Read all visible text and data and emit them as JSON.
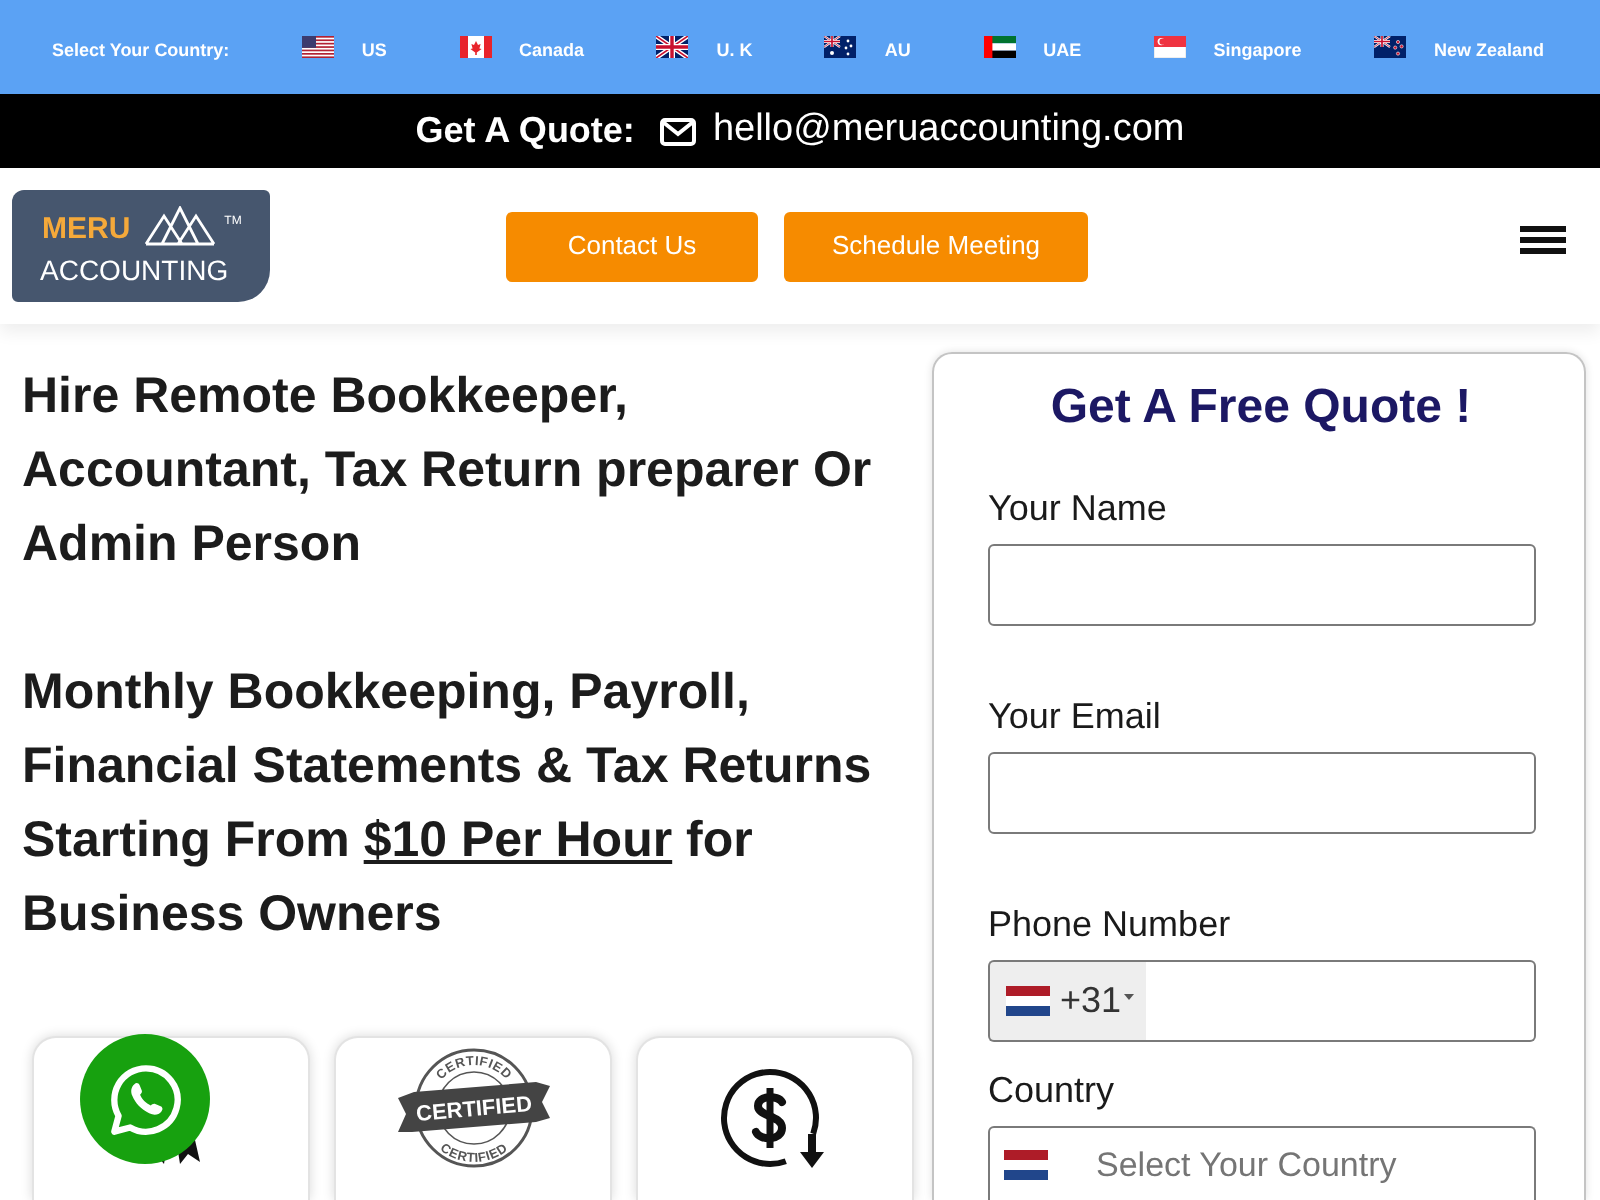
{
  "country_bar": {
    "label": "Select Your Country:",
    "countries": [
      {
        "name": "US"
      },
      {
        "name": "Canada"
      },
      {
        "name": "U. K"
      },
      {
        "name": "AU"
      },
      {
        "name": "UAE"
      },
      {
        "name": "Singapore"
      },
      {
        "name": "New Zealand"
      }
    ]
  },
  "quote_bar": {
    "label": "Get A Quote:",
    "email": "hello@meruaccounting.com"
  },
  "header": {
    "logo": {
      "top_text": "MERU",
      "bottom_text": "ACCOUNTING",
      "trademark": "TM"
    },
    "buttons": [
      {
        "label": "Contact Us"
      },
      {
        "label": "Schedule Meeting"
      }
    ]
  },
  "intro": {
    "headline": "Hire Remote Bookkeeper, Accountant, Tax Return preparer Or Admin Person",
    "offer": {
      "text_before": "Monthly Bookkeeping, Payroll, Financial Statements & Tax Returns Starting From",
      "link": "$10 Per Hour",
      "text_after": "for Business Owners"
    }
  },
  "feature_cards": [
    {
      "kind": "award"
    },
    {
      "kind": "stamp",
      "arc_top": "CERTIFIED",
      "banner": "CERTIFIED",
      "arc_bottom": "CERTIFIED"
    },
    {
      "kind": "dollar"
    }
  ],
  "quote_form": {
    "title": "Get A Free Quote !",
    "fields": [
      {
        "kind": "text",
        "label": "Your Name"
      },
      {
        "kind": "text",
        "label": "Your Email"
      },
      {
        "kind": "phone",
        "label": "Phone Number",
        "dial_code": "+31"
      },
      {
        "kind": "select",
        "label": "Country",
        "placeholder": "Select Your Country"
      }
    ]
  }
}
